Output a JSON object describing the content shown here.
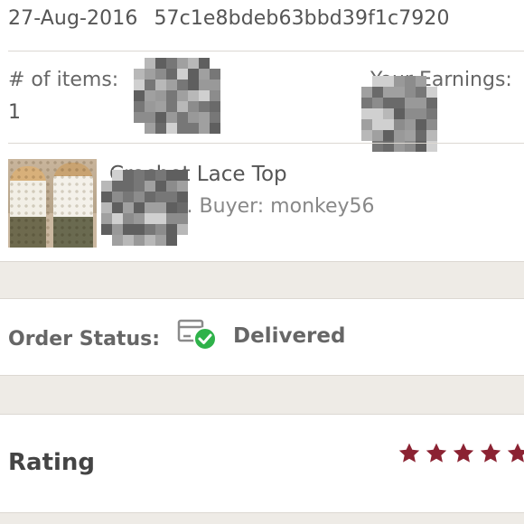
{
  "order": {
    "date": "27-Aug-2016",
    "id": "57c1e8bdeb63bbd39f1c7920",
    "items_label": "# of items:",
    "items_value": "1",
    "earnings_label": "Your Earnings:"
  },
  "product": {
    "title": "Crochet Lace Top",
    "meta": "Size: M . Buyer: monkey56"
  },
  "status": {
    "label": "Order Status:",
    "value": "Delivered"
  },
  "rating": {
    "label": "Rating",
    "stars": 5,
    "star_color": "#8b2232"
  },
  "colors": {
    "background": "#eeebe6",
    "card": "#ffffff",
    "success_green": "#2fb24a"
  }
}
